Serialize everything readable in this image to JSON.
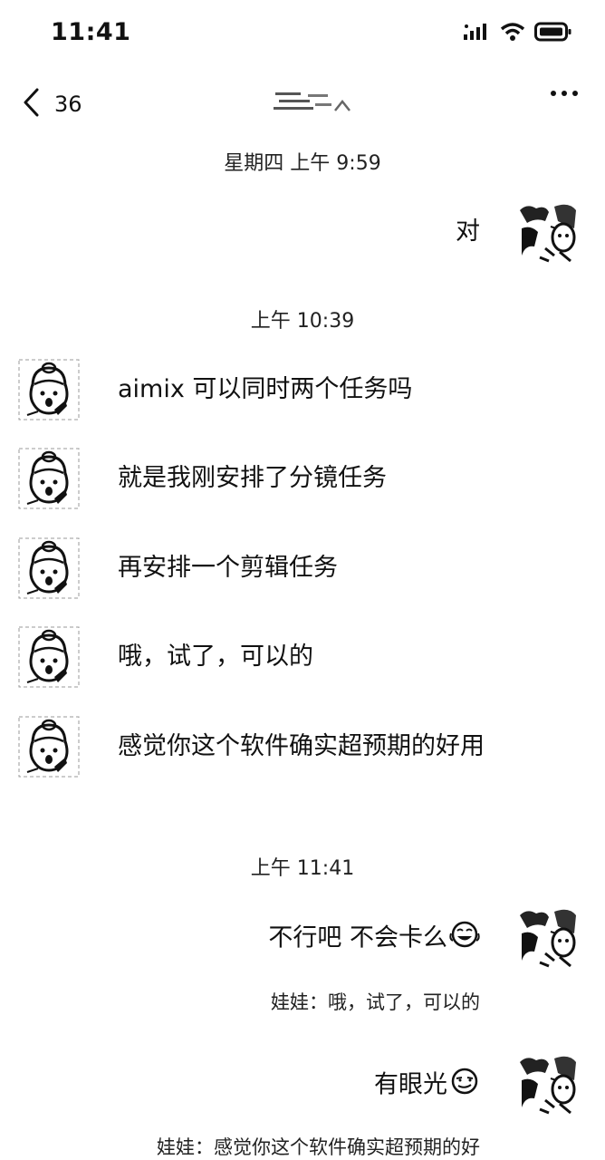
{
  "status_bar": {
    "time": "11:41"
  },
  "nav": {
    "back_count": "36"
  },
  "timestamps": {
    "t1": "星期四 上午 9:59",
    "t2": "上午 10:39",
    "t3": "上午 11:41"
  },
  "messages": [
    {
      "side": "right",
      "text": "对"
    },
    {
      "side": "left",
      "text": "aimix 可以同时两个任务吗"
    },
    {
      "side": "left",
      "text": "就是我刚安排了分镜任务"
    },
    {
      "side": "left",
      "text": "再安排一个剪辑任务"
    },
    {
      "side": "left",
      "text": "哦，试了，可以的"
    },
    {
      "side": "left",
      "text": "感觉你这个软件确实超预期的好用"
    },
    {
      "side": "right",
      "text": "不行吧 不会卡么",
      "emoji": "laughing-tears"
    },
    {
      "side": "right",
      "text": "有眼光",
      "emoji": "smug-face"
    }
  ],
  "quotes": [
    "娃娃：哦，试了，可以的",
    "娃娃：感觉你这个软件确实超预期的好"
  ]
}
